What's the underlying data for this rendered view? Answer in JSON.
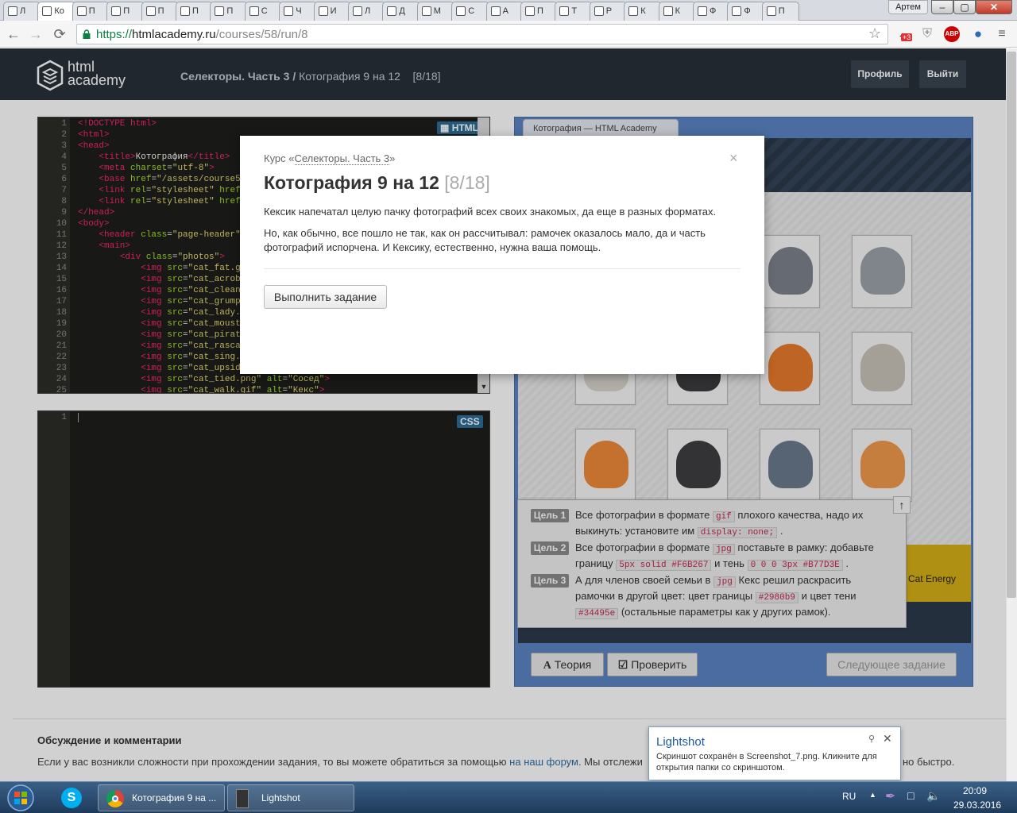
{
  "browser": {
    "tabs_short": [
      "Л",
      "Ко",
      "П",
      "П",
      "П",
      "П",
      "П",
      "С",
      "Ч",
      "И",
      "Л",
      "Д",
      "М",
      "С",
      "А",
      "П",
      "Т",
      "Р",
      "К",
      "К",
      "Ф",
      "Ф",
      "П"
    ],
    "user_label": "Артем",
    "window_buttons": {
      "minimize": "–",
      "maximize": "▢",
      "close": "✕"
    },
    "url_scheme": "https://",
    "url_host": "htmlacademy.ru",
    "url_path": "/courses/58/run/8",
    "ext_badge": "+3",
    "abp": "ABP"
  },
  "site": {
    "logo_line1": "html",
    "logo_line2": "academy",
    "crumb_course": "Селекторы. Часть 3 /",
    "crumb_task": "Котография 9 на 12",
    "crumb_counter": "[8/18]",
    "profile_btn": "Профиль",
    "logout_btn": "Выйти"
  },
  "editor_html": {
    "label": "HTML",
    "lines": [
      {
        "n": "1"
      },
      {
        "n": "2"
      },
      {
        "n": "3"
      },
      {
        "n": "4"
      },
      {
        "n": "5"
      },
      {
        "n": "6"
      },
      {
        "n": "7"
      },
      {
        "n": "8"
      },
      {
        "n": "9"
      },
      {
        "n": "10"
      },
      {
        "n": "11"
      },
      {
        "n": "12"
      },
      {
        "n": "13"
      },
      {
        "n": "14"
      },
      {
        "n": "15"
      },
      {
        "n": "16"
      },
      {
        "n": "17"
      },
      {
        "n": "18"
      },
      {
        "n": "19"
      },
      {
        "n": "20"
      },
      {
        "n": "21"
      },
      {
        "n": "22"
      },
      {
        "n": "23"
      },
      {
        "n": "24"
      },
      {
        "n": "25"
      }
    ]
  },
  "editor_css": {
    "label": "CSS",
    "line": "1"
  },
  "preview": {
    "tab_title": "Котография — HTML Academy",
    "cat_energy": "Cat Energy",
    "goals": [
      {
        "badge": "Цель 1",
        "t1": "Все фотографии в формате",
        "c1": "gif",
        "t2": "плохого качества, надо их выкинуть: установите им",
        "c2": "display: none;",
        "t3": "."
      },
      {
        "badge": "Цель 2",
        "t1": "Все фотографии в формате",
        "c1": "jpg",
        "t2": "поставьте в рамку: добавьте границу",
        "c2": "5px solid #F6B267",
        "t3": "и тень",
        "c3": "0 0 0 3px #B77D3E",
        "t4": "."
      },
      {
        "badge": "Цель 3",
        "t1": "А для членов своей семьи в",
        "c1": "jpg",
        "t2": "Кекс решил раскрасить рамочки в другой цвет: цвет границы",
        "c2": "#2980b9",
        "t3": "и цвет тени",
        "c3": "#34495e",
        "t4": "(остальные параметры как у других рамок)."
      }
    ],
    "theory_btn": "Теория",
    "check_btn": "Проверить",
    "next_btn": "Следующее задание"
  },
  "discussion": {
    "title": "Обсуждение и комментарии",
    "text1": "Если у вас возникли сложности при прохождении задания, то вы можете обратиться за помощью",
    "link": "на наш форум",
    "text2": ". Мы отслежи",
    "text3": "но быстро."
  },
  "modal": {
    "course_prefix": "Курс «",
    "course_link": "Селекторы. Часть 3",
    "course_suffix": "»",
    "title": "Котография 9 на 12",
    "counter": "[8/18]",
    "close": "×",
    "p1": "Кексик напечатал целую пачку фотографий всех своих знакомых, да еще в разных форматах.",
    "p2": "Но, как обычно, все пошло не так, как он рассчитывал: рамочек оказалось мало, да и часть фотографий испорчена. И Кексику, естественно, нужна ваша помощь.",
    "button": "Выполнить задание"
  },
  "lightshot": {
    "title": "Lightshot",
    "text": "Скриншот сохранён в Screenshot_7.png. Кликните для открытия папки со скриншотом.",
    "close": "✕",
    "pin": "⚲"
  },
  "taskbar": {
    "task1": "Котография 9 на ...",
    "task2": "Lightshot",
    "lang": "RU",
    "time": "20:09",
    "date": "29.03.2016"
  }
}
